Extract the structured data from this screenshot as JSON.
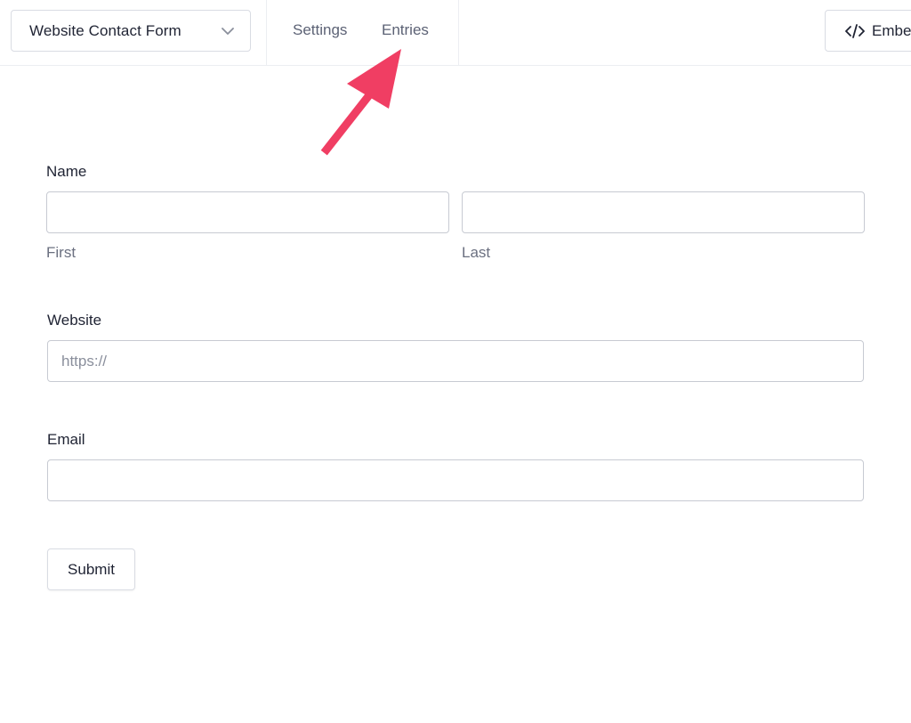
{
  "toolbar": {
    "form_selector": {
      "value": "Website Contact Form",
      "icon": "chevron-down-icon"
    },
    "tabs": [
      {
        "label": "Settings"
      },
      {
        "label": "Entries"
      }
    ],
    "embed_button": {
      "label": "Embed",
      "icon": "code-icon"
    }
  },
  "annotation": {
    "icon": "arrow-icon",
    "color": "#f03e63",
    "points_to": "Entries"
  },
  "form": {
    "name": {
      "label": "Name",
      "first_sublabel": "First",
      "last_sublabel": "Last",
      "first_value": "",
      "last_value": ""
    },
    "website": {
      "label": "Website",
      "placeholder": "https://",
      "value": ""
    },
    "email": {
      "label": "Email",
      "value": ""
    },
    "submit_label": "Submit"
  },
  "colors": {
    "text": "#1f2333",
    "muted_text": "#5c6275",
    "border": "#c7cad2",
    "accent_arrow": "#f03e63"
  }
}
